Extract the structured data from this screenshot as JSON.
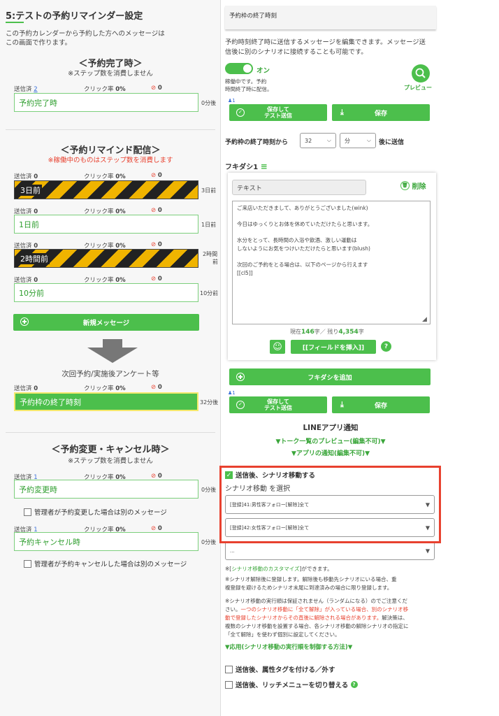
{
  "left": {
    "title": "5:テストの予約リマインダー設定",
    "desc1": "この予約カレンダーから予約した方へのメッセージは",
    "desc2": "この画面で作ります。",
    "complete_heading": "＜予約完了時＞",
    "complete_note": "※ステップ数を消費しません",
    "remind_heading": "＜予約リマインド配信＞",
    "remind_note": "※稼働中のものはステップ数を消費します",
    "change_heading": "＜予約変更・キャンセル時＞",
    "change_note": "※ステップ数を消費しません",
    "stat_sent": "送信済",
    "stat_click": "クリック率",
    "stats": [
      {
        "sent": "2",
        "rate": "0%",
        "block": "0"
      },
      {
        "sent": "0",
        "rate": "0%",
        "block": "0"
      },
      {
        "sent": "0",
        "rate": "0%",
        "block": "0"
      },
      {
        "sent": "0",
        "rate": "0%",
        "block": "0"
      },
      {
        "sent": "0",
        "rate": "0%",
        "block": "0"
      },
      {
        "sent": "0",
        "rate": "0%",
        "block": "0"
      },
      {
        "sent": "1",
        "rate": "0%",
        "block": "0"
      },
      {
        "sent": "1",
        "rate": "0%",
        "block": "0"
      }
    ],
    "steps": [
      {
        "label": "予約完了時",
        "after": "0分後"
      },
      {
        "label": "3日前",
        "after": "3日前"
      },
      {
        "label": "1日前",
        "after": "1日前"
      },
      {
        "label": "2時間前",
        "after1": "2時間",
        "after2": "前"
      },
      {
        "label": "10分前",
        "after": "10分前"
      },
      {
        "label": "予約枠の終了時刻",
        "after": "32分後"
      },
      {
        "label": "予約変更時",
        "after": "0分後"
      },
      {
        "label": "予約キャンセル時",
        "after": "0分後"
      }
    ],
    "new_message": "新規メッセージ",
    "next_label": "次回予約/実施後アンケート等",
    "admin_change": "管理者が予約変更した場合は別のメッセージ",
    "admin_cancel": "管理者が予約キャンセルした場合は別のメッセージ"
  },
  "right": {
    "tab_title": "予約枠の終了時刻",
    "desc1": "予約時刻終了時に送信するメッセージを編集できます。メッセージ送",
    "desc2": "信後に別のシナリオに接続することも可能です。",
    "toggle_label": "オン",
    "status1": "稼働中です。予約",
    "status2": "時間終了時に配信。",
    "preview": "プレビュー",
    "count": "1",
    "save_test1": "保存して",
    "save_test2": "テスト送信",
    "save": "保存",
    "timing_prefix": "予約枠の終了時刻から",
    "timing_value": "32",
    "timing_unit": "分",
    "timing_suffix": "後に送信",
    "bubble_title": "フキダシ1",
    "type_value": "テキスト",
    "delete": "削除",
    "message_lines": [
      "ご来店いただきまして、ありがとうございました(wink)",
      "",
      "今日はゆっくりとお体を休めていただけたらと思います。",
      "",
      "水分をとって、長時間の入浴や飲酒、激しい運動は",
      "しないようにお気をつけいただけたらと思います(blush)",
      "",
      "次回のご予約をとる場合は、以下のページから行えます",
      "[[cl5]]"
    ],
    "char_now": "現在",
    "char_count": "146",
    "char_mid": "字／ 残り",
    "char_remain": "4,354",
    "char_unit": "字",
    "insert_field": "[[フィールドを挿入]]",
    "add_bubble": "フキダシを追加",
    "count2": "1",
    "line_notice": "LINEアプリ通知",
    "talk_preview": "▼トーク一覧のプレビュー(編集不可)▼",
    "app_notice": "▼アプリの通知(編集不可)▼",
    "scenario_move": "送信後、シナリオ移動する",
    "scenario_select": "シナリオ移動 を選択",
    "option1": "[登録]41:男性客フォロー[解除]全て",
    "option2": "[登録]42:女性客フォロー[解除]全て",
    "option3": "...",
    "note_customize_a": "※[",
    "note_customize_link": "シナリオ移動のカスタマイズ",
    "note_customize_b": "]ができます。",
    "note2_l1": "※シナリオ解除後に登録します。解除後も移動先シナリオにいる場合、重",
    "note2_l2": "複登録を避けるためシナリオ末尾に到達済みの場合に限り登録します。",
    "note3_l1": "※シナリオ移動の実行順は保証されません（ランダムになる）のでご注意くだ",
    "note3_l2a": "さい。",
    "note3_l2b": "一つのシナリオ移動に「全て解除」が入っている場合、別のシナリオ移",
    "note3_l3": "動で登録したシナリオからその直後に解除される場合があります。",
    "note3_l3b": "解決策は、",
    "note3_l4": "複数のシナリオ移動を設置する場合、各シナリオ移動の解除シナリオの指定に",
    "note3_l5": "「全て解除」を使わず個別に設定してください。",
    "applied_link": "▼応用(シナリオ移動の実行順を制御する方法)▼",
    "tag_option": "送信後、属性タグを付ける／外す",
    "rich_option": "送信後、リッチメニューを切り替える"
  },
  "colors": {
    "accent": "#4cbf4c",
    "highlight_box": "#e8412f"
  }
}
